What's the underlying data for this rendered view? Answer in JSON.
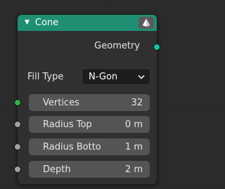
{
  "node": {
    "title": "Cone",
    "header_color": "#1e8f73",
    "collapse_icon": "triangle-down-icon",
    "type_icon": "cone-icon",
    "output": {
      "label": "Geometry",
      "socket_color": "#18c3a0"
    },
    "fill_type": {
      "label": "Fill Type",
      "value": "N-Gon",
      "icon": "chevron-down-icon"
    },
    "inputs": [
      {
        "label": "Vertices",
        "value": "32",
        "socket_color": "#35b14a"
      },
      {
        "label": "Radius Top",
        "value": "0 m",
        "socket_color": "#a1a1a1"
      },
      {
        "label": "Radius Botto",
        "value": "1 m",
        "socket_color": "#a1a1a1"
      },
      {
        "label": "Depth",
        "value": "2 m",
        "socket_color": "#a1a1a1"
      }
    ]
  }
}
